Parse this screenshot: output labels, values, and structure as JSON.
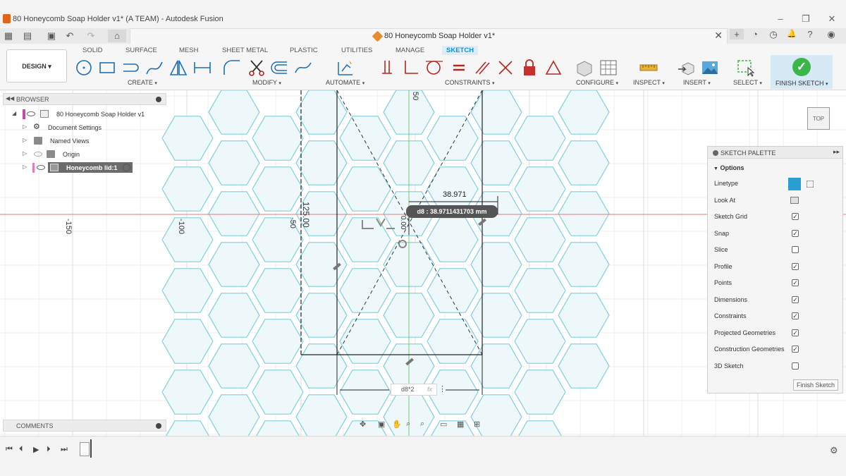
{
  "window": {
    "title": "80 Honeycomb Soap Holder v1* (A TEAM) - Autodesk Fusion",
    "controls": [
      "–",
      "❐",
      "✕"
    ]
  },
  "document_tab": {
    "title": "80 Honeycomb Soap Holder v1*",
    "close": "✕"
  },
  "quick_access": {
    "apps": "▦",
    "file": "▤",
    "save": "▣",
    "undo": "↶",
    "redo": "↷",
    "home": "⌂",
    "add_tab": "+",
    "extensions": "◔",
    "job_status": "◷",
    "notifications": "🔔",
    "help": "?",
    "profile": "◉"
  },
  "ribbon": {
    "workspace": "DESIGN",
    "tabs": [
      "SOLID",
      "SURFACE",
      "MESH",
      "SHEET METAL",
      "PLASTIC",
      "UTILITIES",
      "MANAGE",
      "SKETCH"
    ],
    "active_tab": "SKETCH",
    "groups": {
      "create": "CREATE",
      "modify": "MODIFY",
      "automate": "AUTOMATE",
      "constraints": "CONSTRAINTS",
      "configure": "CONFIGURE",
      "inspect": "INSPECT",
      "insert": "INSERT",
      "select": "SELECT"
    },
    "caret": "▾",
    "finish_sketch": "FINISH SKETCH",
    "finish_icon": "✓"
  },
  "browser": {
    "header": "BROWSER",
    "items": [
      {
        "label": "80 Honeycomb Soap Holder v1"
      },
      {
        "label": "Document Settings"
      },
      {
        "label": "Named Views"
      },
      {
        "label": "Origin"
      },
      {
        "label": "Honeycomb lid:1"
      }
    ]
  },
  "comments": {
    "header": "COMMENTS"
  },
  "viewcube": {
    "face": "TOP"
  },
  "canvas": {
    "axis_labels": [
      "-150",
      "-100",
      "-50",
      "50"
    ],
    "vertical_dimension": "125.00",
    "small_dimension": "0.00",
    "dimension_value": "38.971",
    "dimension_tooltip": "d8 : 38.9711431703 mm",
    "dimension_input": "d8*2",
    "fx": "fx",
    "more": "⋮"
  },
  "sketch_palette": {
    "title": "SKETCH PALETTE",
    "section": "Options",
    "options": [
      {
        "label": "Linetype"
      },
      {
        "label": "Look At"
      },
      {
        "label": "Sketch Grid",
        "checked": true
      },
      {
        "label": "Snap",
        "checked": true
      },
      {
        "label": "Slice",
        "checked": false
      },
      {
        "label": "Profile",
        "checked": true
      },
      {
        "label": "Points",
        "checked": true
      },
      {
        "label": "Dimensions",
        "checked": true
      },
      {
        "label": "Constraints",
        "checked": true
      },
      {
        "label": "Projected Geometries",
        "checked": true
      },
      {
        "label": "Construction Geometries",
        "checked": true
      },
      {
        "label": "3D Sketch",
        "checked": false
      }
    ],
    "check_mark": "✓",
    "finish_button": "Finish Sketch"
  },
  "timeline": {
    "buttons": [
      "⏮",
      "⏴",
      "▶",
      "⏵",
      "⏭"
    ],
    "settings": "⚙"
  },
  "colors": {
    "accent": "#1e8fd0",
    "finish": "#3cb54a",
    "hex_stroke": "#7ecfdc",
    "hex_fill": "#eef8fb",
    "axis_red": "#e07a7a",
    "axis_green": "#7cc47c"
  }
}
